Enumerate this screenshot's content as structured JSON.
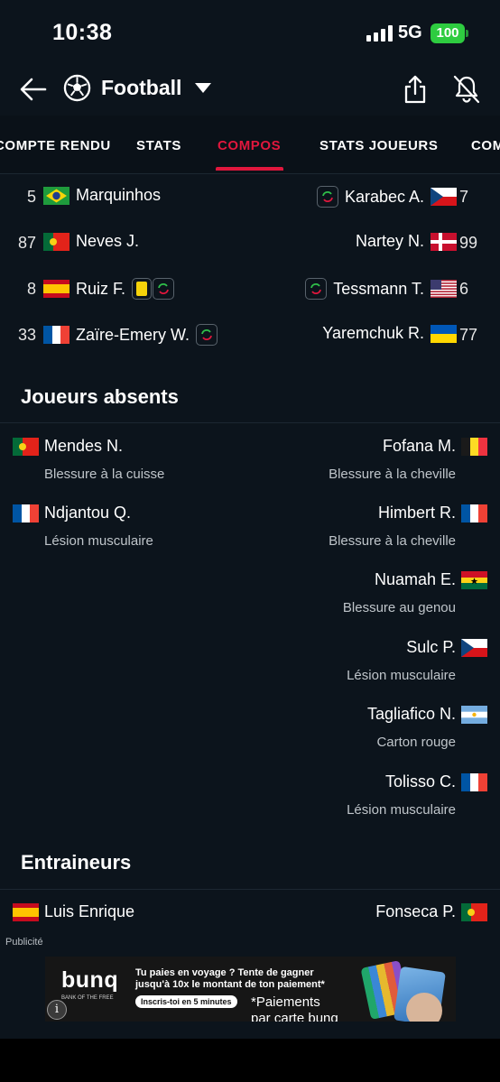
{
  "status": {
    "time": "10:38",
    "network": "5G",
    "battery": "100"
  },
  "appbar": {
    "sport": "Football"
  },
  "tabs": [
    {
      "label": "COMPTE RENDU",
      "active": false
    },
    {
      "label": "STATS",
      "active": false
    },
    {
      "label": "COMPOS",
      "active": true
    },
    {
      "label": "STATS JOUEURS",
      "active": false
    },
    {
      "label": "COM",
      "active": false
    }
  ],
  "lineup": [
    {
      "home": {
        "number": "5",
        "name": "Marquinhos",
        "flag": "brazil"
      },
      "away": {
        "number": "7",
        "name": "Karabec A.",
        "flag": "czech",
        "sub": true
      }
    },
    {
      "home": {
        "number": "87",
        "name": "Neves J.",
        "flag": "portugal"
      },
      "away": {
        "number": "99",
        "name": "Nartey N.",
        "flag": "denmark"
      }
    },
    {
      "home": {
        "number": "8",
        "name": "Ruiz F.",
        "flag": "spain",
        "yellow": true,
        "sub": true
      },
      "away": {
        "number": "6",
        "name": "Tessmann T.",
        "flag": "usa",
        "sub": true
      }
    },
    {
      "home": {
        "number": "33",
        "name": "Zaïre-Emery W.",
        "flag": "france",
        "sub": true
      },
      "away": {
        "number": "77",
        "name": "Yaremchuk R.",
        "flag": "ukraine"
      }
    }
  ],
  "absent": {
    "title": "Joueurs absents",
    "home": [
      {
        "name": "Mendes N.",
        "reason": "Blessure à la cuisse",
        "flag": "portugal"
      },
      {
        "name": "Ndjantou Q.",
        "reason": "Lésion musculaire",
        "flag": "france"
      }
    ],
    "away": [
      {
        "name": "Fofana M.",
        "reason": "Blessure à la cheville",
        "flag": "belgium"
      },
      {
        "name": "Himbert R.",
        "reason": "Blessure à la cheville",
        "flag": "france"
      },
      {
        "name": "Nuamah E.",
        "reason": "Blessure au genou",
        "flag": "ghana"
      },
      {
        "name": "Sulc P.",
        "reason": "Lésion musculaire",
        "flag": "czech"
      },
      {
        "name": "Tagliafico N.",
        "reason": "Carton rouge",
        "flag": "argentina"
      },
      {
        "name": "Tolisso C.",
        "reason": "Lésion musculaire",
        "flag": "france"
      }
    ]
  },
  "coaches": {
    "title": "Entraineurs",
    "home": {
      "name": "Luis Enrique",
      "flag": "spain"
    },
    "away": {
      "name": "Fonseca P.",
      "flag": "portugal"
    }
  },
  "ad": {
    "label": "Publicité",
    "brand": "bunq",
    "brand_sub": "BANK OF THE FREE",
    "line1": "Tu paies en voyage ? Tente de gagner",
    "line2": "jusqu'à 10x le montant de ton paiement*",
    "button": "Inscris-toi en 5 minutes",
    "note1": "*Paiements",
    "note2": "par carte bunq",
    "info": "i"
  },
  "colors": {
    "accent": "#e0173d",
    "background": "#0c141c",
    "battery": "#2ecc40",
    "yellow_card": "#f5d20a"
  }
}
